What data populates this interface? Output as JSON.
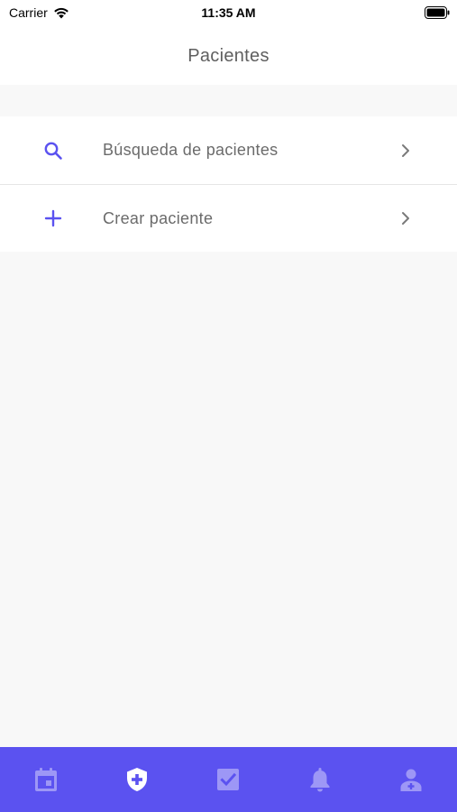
{
  "status_bar": {
    "carrier": "Carrier",
    "time": "11:35 AM",
    "wifi_icon": "wifi-icon",
    "battery_icon": "battery-icon"
  },
  "header": {
    "title": "Pacientes"
  },
  "menu": {
    "items": [
      {
        "label": "Búsqueda de pacientes",
        "icon": "search-icon",
        "trailing_icon": "chevron-right-icon"
      },
      {
        "label": "Crear paciente",
        "icon": "plus-icon",
        "trailing_icon": "chevron-right-icon"
      }
    ]
  },
  "tab_bar": {
    "tabs": [
      {
        "icon": "calendar-icon",
        "active": false
      },
      {
        "icon": "shield-plus-icon",
        "active": true
      },
      {
        "icon": "checkbox-icon",
        "active": false
      },
      {
        "icon": "bell-icon",
        "active": false
      },
      {
        "icon": "user-plus-icon",
        "active": false
      }
    ]
  },
  "colors": {
    "accent": "#5b52f0",
    "tab_inactive": "#9d97f6",
    "tab_active": "#ffffff",
    "label_text": "#6b6b6b",
    "title_text": "#5f5f5f",
    "background": "#f8f8f8"
  }
}
